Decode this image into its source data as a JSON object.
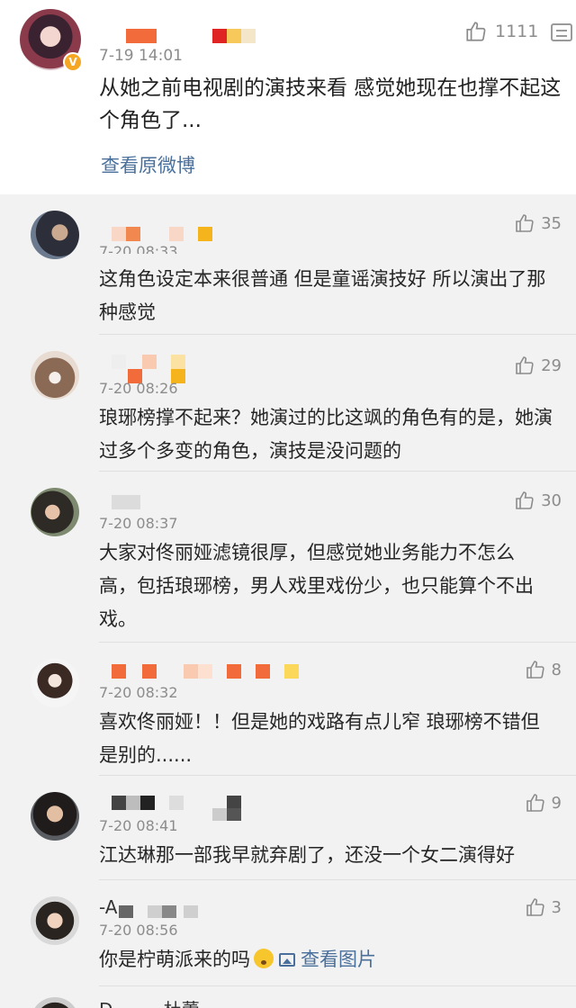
{
  "main_comment": {
    "time": "7-19 14:01",
    "text": "从她之前电视剧的演技来看 感觉她现在也撑不起这个角色了...",
    "like_count": "1111",
    "link_label": "查看原微博",
    "verified_badge": "V",
    "icons": [
      "thumbs-up-icon",
      "more-menu-icon",
      "verified-icon"
    ]
  },
  "replies": [
    {
      "time": "7-20 08:33",
      "text": "这角色设定本来很普通  但是童谣演技好 所以演出了那种感觉",
      "like_count": "35"
    },
    {
      "time": "7-20 08:26",
      "text": "琅琊榜撑不起来？她演过的比这飒的角色有的是，她演过多个多变的角色，演技是没问题的",
      "like_count": "29"
    },
    {
      "time": "7-20 08:37",
      "text": "大家对佟丽娅滤镜很厚，但感觉她业务能力不怎么高，包括琅琊榜，男人戏里戏份少，也只能算个不出戏。",
      "like_count": "30"
    },
    {
      "time": "7-20 08:32",
      "text": "喜欢佟丽娅！！但是她的戏路有点儿窄 琅琊榜不错但是别的......",
      "like_count": "8"
    },
    {
      "time": "7-20 08:41",
      "text": "江达琳那一部我早就弃剧了，还没一个女二演得好",
      "like_count": "9"
    },
    {
      "name_prefix": "-A",
      "time": "7-20 08:56",
      "text": "你是柠萌派来的吗",
      "pic_link": "查看图片",
      "like_count": "3"
    },
    {
      "name_prefix": "D",
      "name_suffix": "杜蕾"
    }
  ],
  "colors": {
    "link": "#4a6f9b",
    "timestamp": "#8c8c8c",
    "background": "#f2f2f2",
    "card": "#ffffff",
    "verified_badge": "#f5a623"
  }
}
